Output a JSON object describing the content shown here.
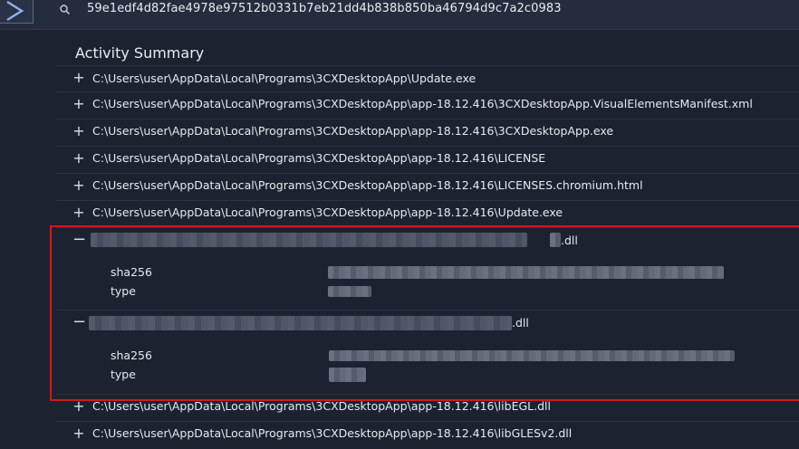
{
  "search": {
    "value": "59e1edf4d82fae4978e97512b0331b7eb21dd4b838b850ba46794d9c7a2c0983"
  },
  "panel": {
    "title": "Activity Summary"
  },
  "files_top": [
    "C:\\Users\\user\\AppData\\Local\\Programs\\3CXDesktopApp\\Update.exe",
    "C:\\Users\\user\\AppData\\Local\\Programs\\3CXDesktopApp\\app-18.12.416\\3CXDesktopApp.VisualElementsManifest.xml",
    "C:\\Users\\user\\AppData\\Local\\Programs\\3CXDesktopApp\\app-18.12.416\\3CXDesktopApp.exe",
    "C:\\Users\\user\\AppData\\Local\\Programs\\3CXDesktopApp\\app-18.12.416\\LICENSE",
    "C:\\Users\\user\\AppData\\Local\\Programs\\3CXDesktopApp\\app-18.12.416\\LICENSES.chromium.html",
    "C:\\Users\\user\\AppData\\Local\\Programs\\3CXDesktopApp\\app-18.12.416\\Update.exe"
  ],
  "expanded": [
    {
      "suffix": ".dll",
      "key_sha": "sha256",
      "key_type": "type"
    },
    {
      "suffix": ".dll",
      "key_sha": "sha256",
      "key_type": "type"
    }
  ],
  "files_bottom": [
    "C:\\Users\\user\\AppData\\Local\\Programs\\3CXDesktopApp\\app-18.12.416\\libEGL.dll",
    "C:\\Users\\user\\AppData\\Local\\Programs\\3CXDesktopApp\\app-18.12.416\\libGLESv2.dll"
  ],
  "icons": {
    "expand": "plus-icon",
    "collapse": "minus-icon",
    "search": "search-icon",
    "logo": "chevron-logo-icon"
  },
  "colors": {
    "background": "#1c2230",
    "highlight": "#d21818",
    "topbar": "#252c3b"
  }
}
